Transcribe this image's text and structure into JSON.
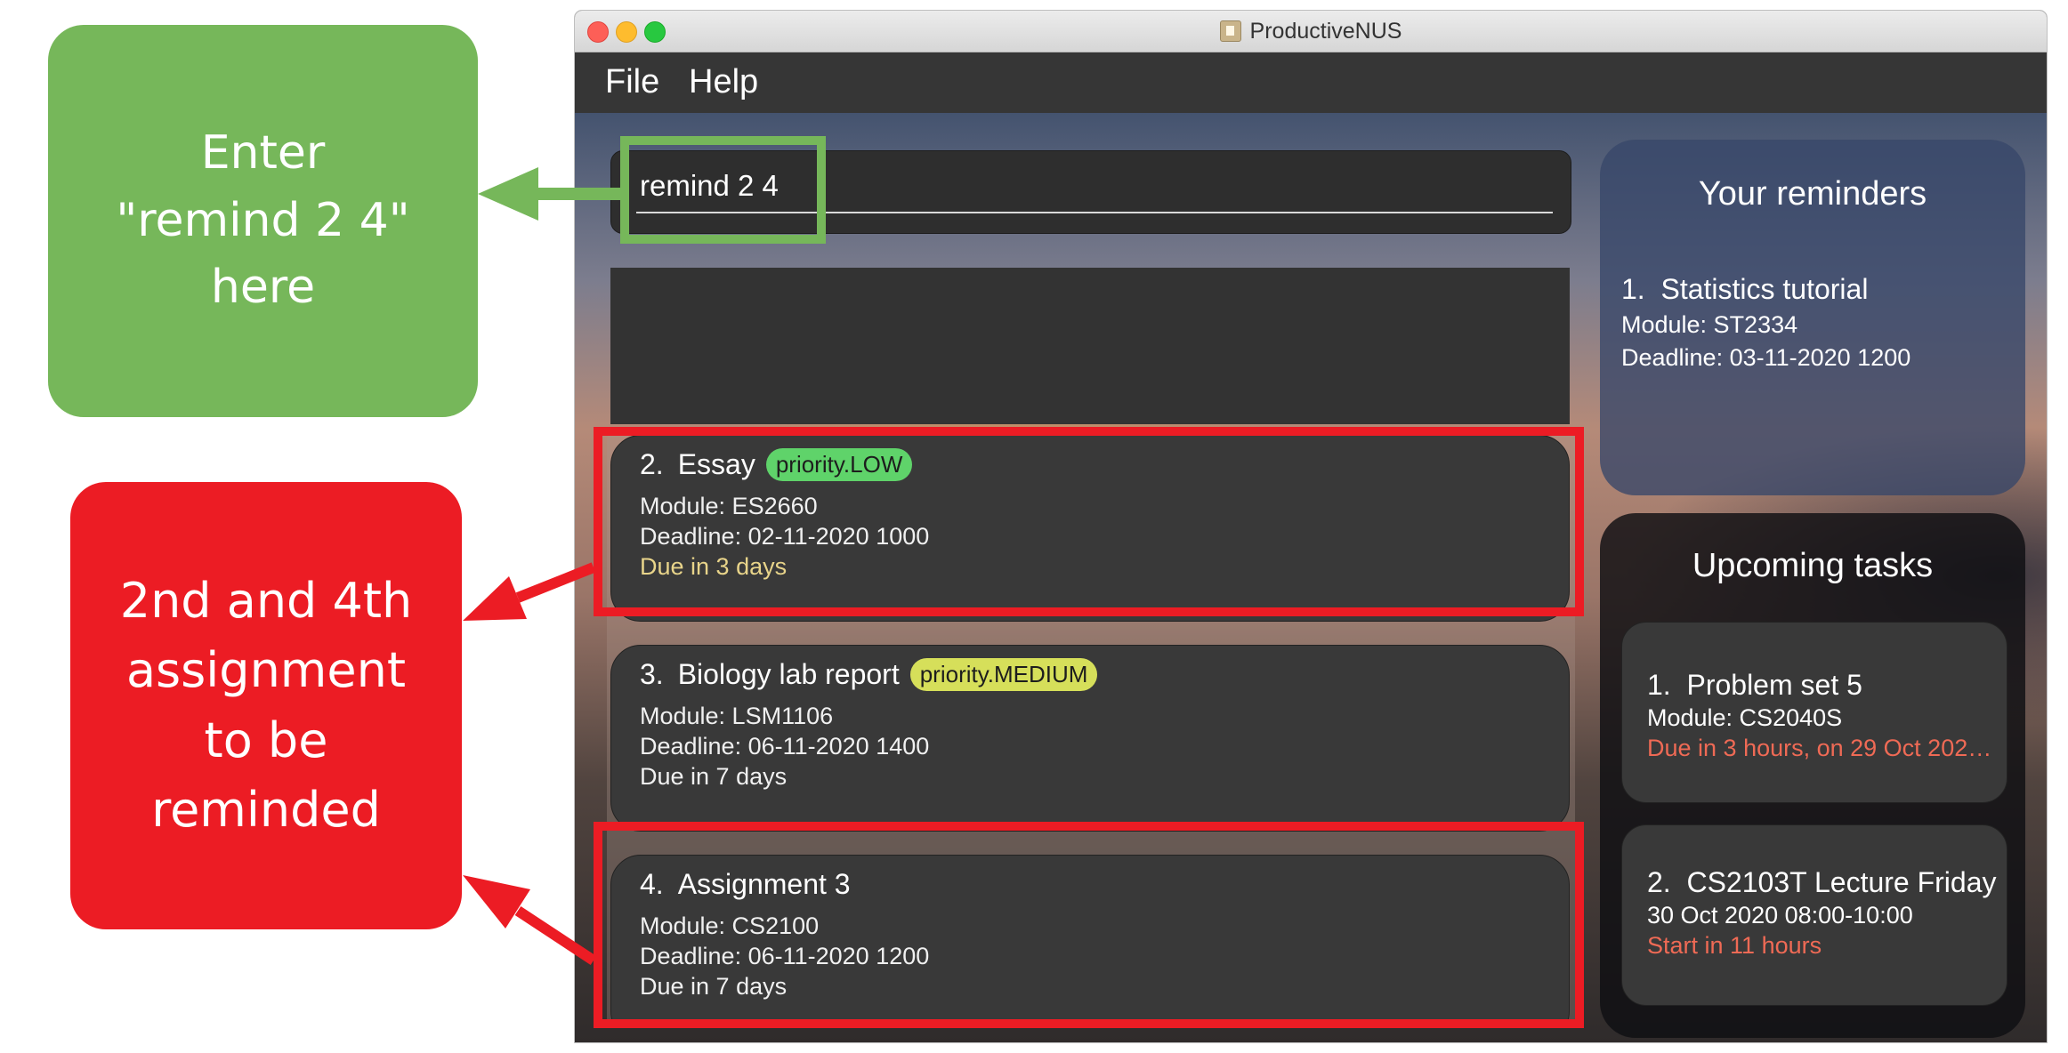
{
  "colors": {
    "annotation_green": "#76b75a",
    "annotation_red": "#ec1c24",
    "priority_low": "#5fd36a",
    "priority_medium": "#d6df5a",
    "due_warning": "#e8d48a",
    "due_urgent": "#ef6a55"
  },
  "annotations": {
    "green_lines": [
      "Enter",
      "\"remind 2 4\"",
      "here"
    ],
    "red_lines": [
      "2nd and 4th",
      "assignment",
      "to be",
      "reminded"
    ]
  },
  "window": {
    "title": "ProductiveNUS"
  },
  "menu": {
    "file": "File",
    "help": "Help"
  },
  "command": {
    "value": "remind 2 4"
  },
  "result": {
    "text": ""
  },
  "tasks": [
    {
      "index": "2.",
      "name": "Essay",
      "priority": "priority.LOW",
      "module": "Module: ES2660",
      "deadline": "Deadline: 02-11-2020 1000",
      "due": "Due in 3 days"
    },
    {
      "index": "3.",
      "name": "Biology lab report",
      "priority": "priority.MEDIUM",
      "module": "Module: LSM1106",
      "deadline": "Deadline: 06-11-2020 1400",
      "due": "Due in 7 days"
    },
    {
      "index": "4.",
      "name": "Assignment 3",
      "priority": "",
      "module": "Module: CS2100",
      "deadline": "Deadline: 06-11-2020 1200",
      "due": "Due in 7 days"
    }
  ],
  "reminders": {
    "title": "Your reminders",
    "items": [
      {
        "index": "1.",
        "name": "Statistics tutorial",
        "module": "Module: ST2334",
        "deadline": "Deadline: 03-11-2020 1200"
      }
    ]
  },
  "upcoming": {
    "title": "Upcoming tasks",
    "items": [
      {
        "index": "1.",
        "name": "Problem set 5",
        "line1": "Module: CS2040S",
        "line2": "Due in 3 hours, on 29 Oct 2020 2..."
      },
      {
        "index": "2.",
        "name": "CS2103T Lecture Friday",
        "line1": "30 Oct 2020 08:00-10:00",
        "line2": "Start in 11 hours"
      }
    ]
  }
}
